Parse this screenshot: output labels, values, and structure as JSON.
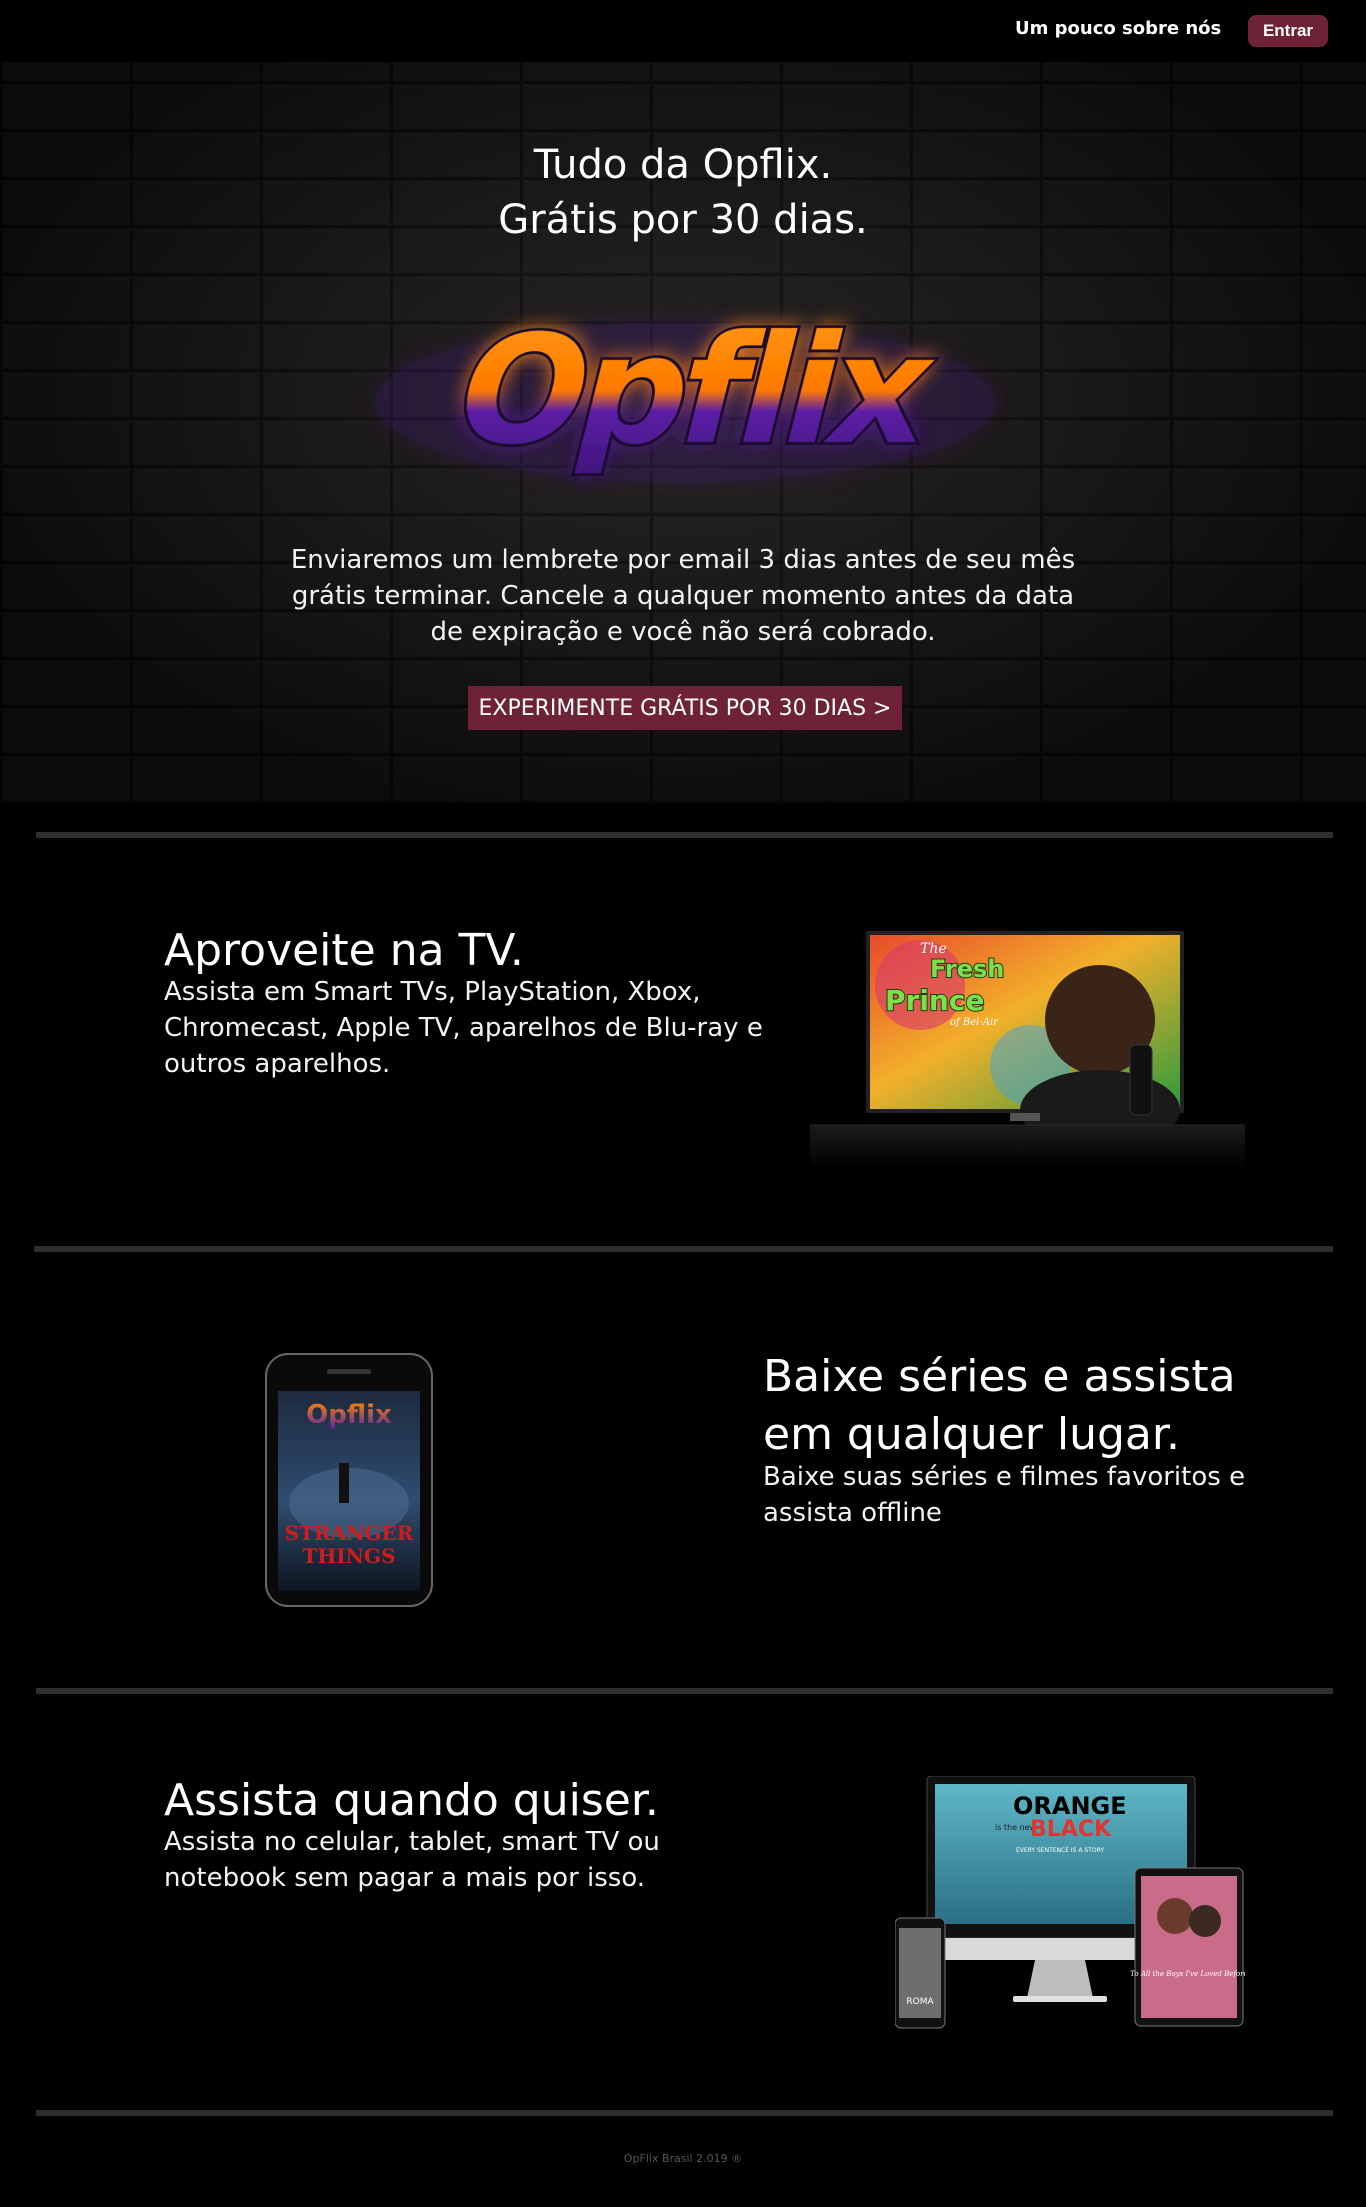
{
  "header": {
    "about_label": "Um pouco sobre nós",
    "login_label": "Entrar"
  },
  "hero": {
    "title_line1": "Tudo da Opflix.",
    "title_line2": "Grátis por 30 dias.",
    "logo_text": "Opflix",
    "description": "Enviaremos um lembrete por email 3 dias antes de seu mês grátis terminar.  Cancele a qualquer momento antes da data de expiração e você não será cobrado.",
    "cta_label": "EXPERIMENTE GRÁTIS POR 30 DIAS >"
  },
  "sections": [
    {
      "title": "Aproveite na TV.",
      "text": "Assista em Smart TVs, PlayStation, Xbox, Chromecast, Apple TV, aparelhos de Blu-ray e outros aparelhos.",
      "image_text": {
        "line1": "The",
        "line2": "Fresh",
        "line3": "Prince",
        "line4": "of Bel-Air"
      }
    },
    {
      "title": "Baixe séries e assista em qualquer lugar.",
      "text": "Baixe suas séries e filmes favoritos e assista offline",
      "image_text": {
        "logo": "Opflix",
        "line1": "STRANGER",
        "line2": "THINGS"
      }
    },
    {
      "title": "Assista quando quiser.",
      "text": "Assista no celular, tablet, smart TV ou notebook sem pagar a mais por isso.",
      "image_text": {
        "line1": "ORANGE",
        "line2": "is the new",
        "line3": "BLACK",
        "tagline": "EVERY SENTENCE IS A STORY",
        "phone": "ROMA",
        "tablet": "To All the Boys I've Loved Before"
      }
    }
  ],
  "footer": {
    "text": "OpFlix Brasil 2.019 ®"
  },
  "colors": {
    "accent": "#6d2236",
    "logo_top": "#ff8a00",
    "logo_bottom": "#5a1fa0",
    "divider": "#2e2e2e"
  }
}
